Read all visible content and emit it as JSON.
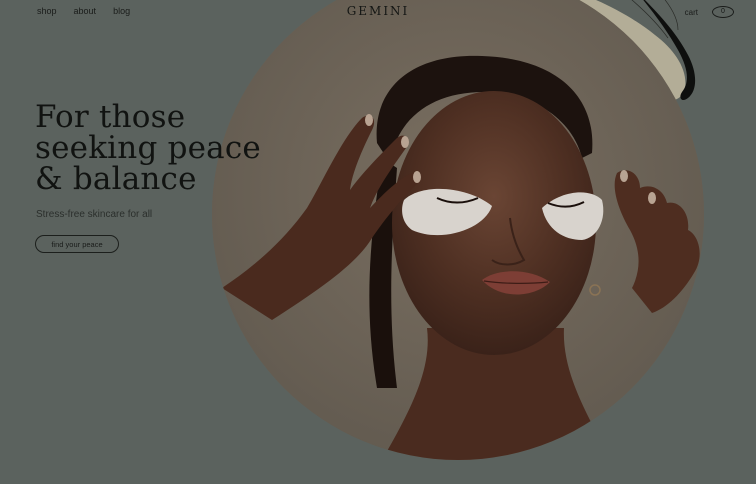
{
  "nav": {
    "links": [
      "shop",
      "about",
      "blog"
    ],
    "logo": "GEMINI",
    "cart_label": "cart",
    "cart_count": "0"
  },
  "hero": {
    "headline": [
      "For those",
      "seeking peace",
      "& balance"
    ],
    "subtext": "Stress-free skincare for all",
    "cta_label": "find your peace"
  },
  "colors": {
    "background": "#5b625e",
    "text": "#141614",
    "accent_stone": "#b5ae98"
  }
}
